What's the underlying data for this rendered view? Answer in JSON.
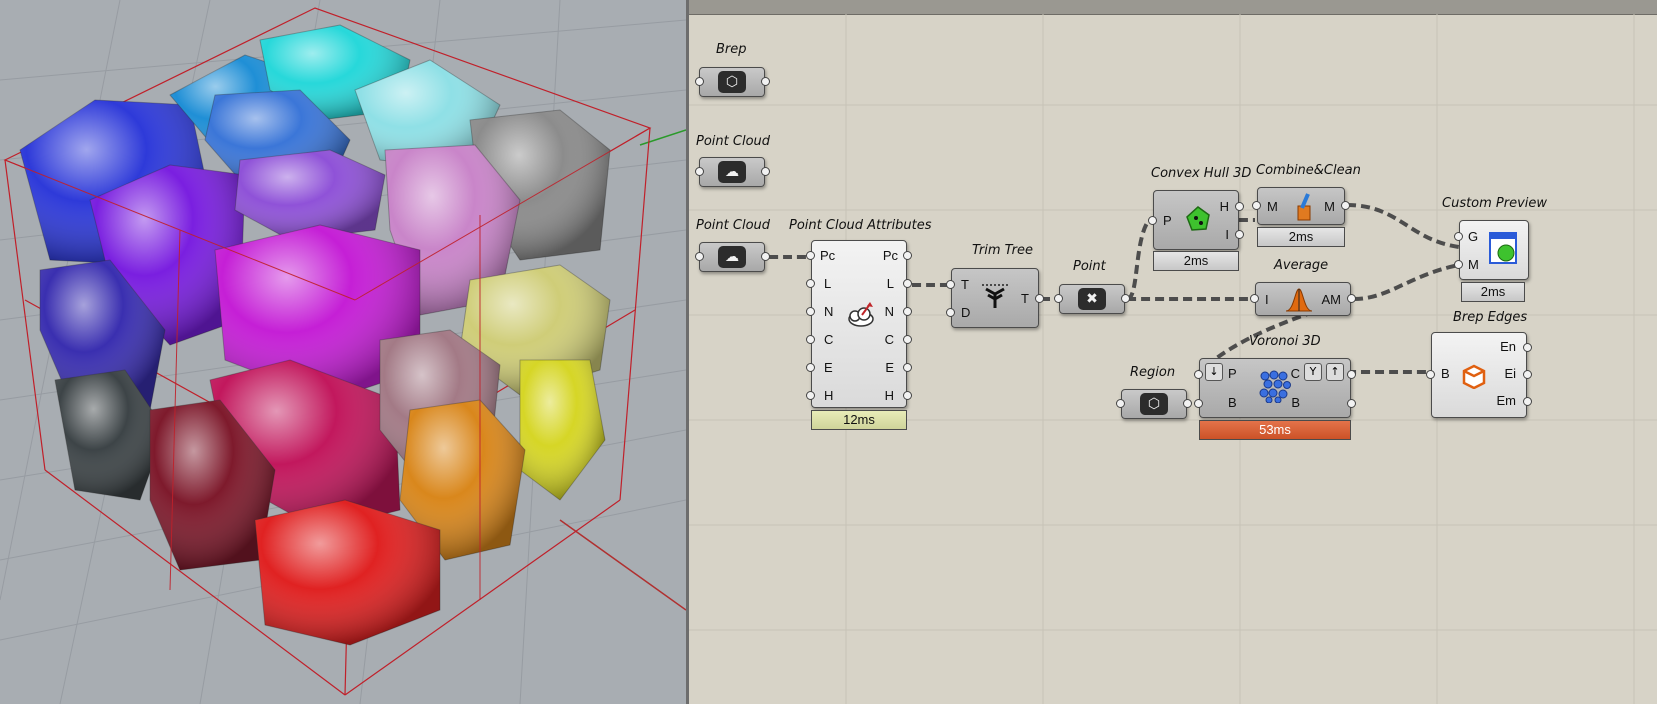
{
  "viewport": {
    "cells": [
      {
        "color": "#2e3ad9"
      },
      {
        "color": "#1f8fd6"
      },
      {
        "color": "#27d8da"
      },
      {
        "color": "#8fe0e6"
      },
      {
        "color": "#3b76d8"
      },
      {
        "color": "#8c8c8c"
      },
      {
        "color": "#7a1fe0"
      },
      {
        "color": "#8f52d8"
      },
      {
        "color": "#c985c9"
      },
      {
        "color": "#3a2fb0"
      },
      {
        "color": "#c51fd6"
      },
      {
        "color": "#cfcd78"
      },
      {
        "color": "#c2185d"
      },
      {
        "color": "#a37a86"
      },
      {
        "color": "#d6d626"
      },
      {
        "color": "#3d4447"
      },
      {
        "color": "#7e1a2c"
      },
      {
        "color": "#d9871c"
      },
      {
        "color": "#e02222"
      }
    ]
  },
  "components": {
    "brep_param": {
      "title": "Brep"
    },
    "point_cloud_param_1": {
      "title": "Point Cloud"
    },
    "point_cloud_param_2": {
      "title": "Point Cloud"
    },
    "point_cloud_attributes": {
      "title": "Point Cloud Attributes",
      "inputs": [
        "Pc",
        "L",
        "N",
        "C",
        "E",
        "H"
      ],
      "outputs": [
        "Pc",
        "L",
        "N",
        "C",
        "E",
        "H"
      ],
      "timer": "12ms"
    },
    "trim_tree": {
      "title": "Trim Tree",
      "inputs": [
        "T",
        "D"
      ],
      "outputs": [
        "T"
      ]
    },
    "point_param": {
      "title": "Point"
    },
    "convex_hull_3d": {
      "title": "Convex Hull 3D",
      "inputs": [
        "P"
      ],
      "outputs": [
        "H",
        "I"
      ],
      "timer": "2ms"
    },
    "combine_clean": {
      "title": "Combine&Clean",
      "inputs": [
        "M"
      ],
      "outputs": [
        "M"
      ],
      "timer": "2ms"
    },
    "custom_preview": {
      "title": "Custom Preview",
      "inputs": [
        "G",
        "M"
      ],
      "timer": "2ms"
    },
    "average": {
      "title": "Average",
      "inputs": [
        "I"
      ],
      "outputs": [
        "AM"
      ]
    },
    "region_param": {
      "title": "Region"
    },
    "voronoi_3d": {
      "title": "Voronoi 3D",
      "inputs": [
        "P",
        "B"
      ],
      "outputs": [
        "C",
        "B"
      ],
      "timer": "53ms"
    },
    "brep_edges": {
      "title": "Brep Edges",
      "inputs": [
        "B"
      ],
      "outputs": [
        "En",
        "Ei",
        "Em"
      ]
    }
  },
  "colors": {
    "canvas_bg": "#d7d3c7",
    "viewport_bg": "#a8adb2",
    "slow_timer": "#cc5227",
    "wire": "#5a5a5a"
  }
}
